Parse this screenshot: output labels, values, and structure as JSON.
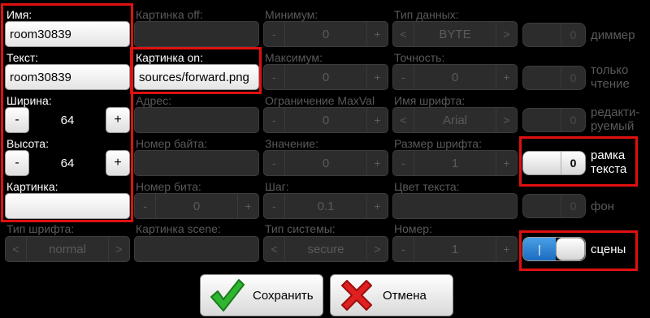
{
  "left": {
    "name_label": "Имя:",
    "name_value": "room30839",
    "text_label": "Текст:",
    "text_value": "room30839",
    "width_label": "Ширина:",
    "width_value": "64",
    "height_label": "Высота:",
    "height_value": "64",
    "image_label": "Картинка:",
    "image_value": "",
    "font_type_label": "Тип шрифта:",
    "font_type_value": "normal",
    "minus": "-",
    "plus": "+",
    "prev": "<",
    "next": ">"
  },
  "col2": {
    "image_off_label": "Картинка off:",
    "image_on_label": "Картинка on:",
    "image_on_value": "sources/forward.png",
    "address_label": "Адрес:",
    "byte_label": "Номер байта:",
    "bit_label": "Номер бита:",
    "bit_value": "0",
    "scene_image_label": "Картинка scene:"
  },
  "col3": {
    "min_label": "Минимум:",
    "min_value": "0",
    "max_label": "Максимум:",
    "max_value": "0",
    "maxval_label": "Ограничение MaxVal",
    "maxval_value": "0",
    "value_label": "Значение:",
    "value_value": "0",
    "step_label": "Шаг:",
    "step_value": "0.1",
    "system_type_label": "Тип системы:",
    "system_type_value": "secure"
  },
  "col4": {
    "data_type_label": "Тип данных:",
    "data_type_value": "BYTE",
    "precision_label": "Точность:",
    "precision_value": "0",
    "font_name_label": "Имя шрифта:",
    "font_name_value": "Arial",
    "font_size_label": "Размер шрифта:",
    "font_size_value": "1",
    "text_color_label": "Цвет текста:",
    "number_label": "Номер:",
    "number_value": "1"
  },
  "toggles": {
    "dimmer": {
      "label": "диммер",
      "value": "0"
    },
    "readonly": {
      "label": "только\nчтение",
      "value": "0"
    },
    "editable": {
      "label": "редакти-\nруемый",
      "value": "0"
    },
    "text_frame": {
      "label": "рамка\nтекста",
      "value": "0"
    },
    "background": {
      "label": "фон",
      "value": "0"
    },
    "scenes": {
      "label": "сцены",
      "value": "|"
    }
  },
  "buttons": {
    "save": "Сохранить",
    "cancel": "Отмена"
  },
  "colors": {
    "highlight": "#e01010",
    "toggle_on": "#1a6bc0",
    "disabled_text": "#5a5a5a"
  }
}
